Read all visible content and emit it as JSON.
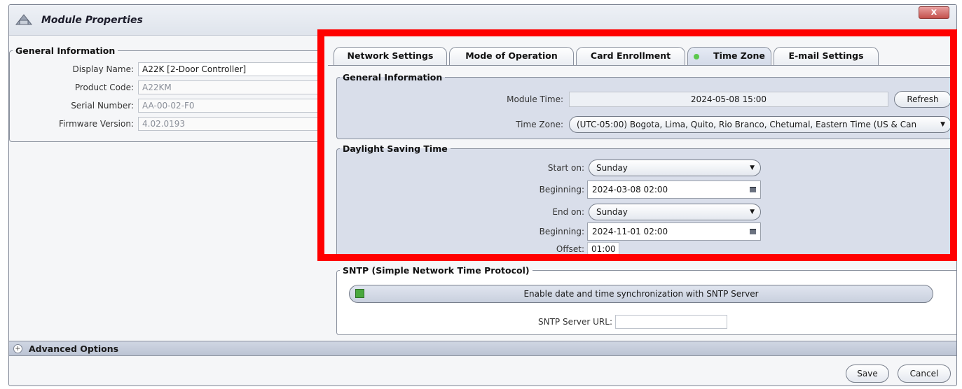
{
  "window": {
    "title": "Module Properties",
    "close_label": "x"
  },
  "general_info_left": {
    "legend": "General Information",
    "fields": [
      {
        "label": "Display Name:",
        "value": "A22K [2-Door Controller]"
      },
      {
        "label": "Product Code:",
        "value": "A22KM"
      },
      {
        "label": "Serial Number:",
        "value": "AA-00-02-F0"
      },
      {
        "label": "Firmware Version:",
        "value": "4.02.0193"
      }
    ]
  },
  "tabs": [
    {
      "label": "Network Settings"
    },
    {
      "label": "Mode of Operation"
    },
    {
      "label": "Card Enrollment"
    },
    {
      "label": "Time Zone",
      "active": true
    },
    {
      "label": "E-mail Settings"
    }
  ],
  "time_zone_tab": {
    "general": {
      "legend": "General Information",
      "module_time_label": "Module Time:",
      "module_time_value": "2024-05-08 15:00",
      "refresh_label": "Refresh",
      "time_zone_label": "Time Zone:",
      "time_zone_value": "(UTC-05:00) Bogota, Lima, Quito, Rio Branco, Chetumal, Eastern Time (US & Can"
    },
    "dst": {
      "legend": "Daylight Saving Time",
      "start_on_label": "Start on:",
      "start_on_value": "Sunday",
      "beginning1_label": "Beginning:",
      "beginning1_value": "2024-03-08 02:00",
      "end_on_label": "End on:",
      "end_on_value": "Sunday",
      "beginning2_label": "Beginning:",
      "beginning2_value": "2024-11-01 02:00",
      "offset_label": "Offset:",
      "offset_value": "01:00"
    },
    "sntp": {
      "legend": "SNTP (Simple Network Time Protocol)",
      "enable_label": "Enable date and time synchronization with SNTP Server",
      "enable_checked": true,
      "url_label": "SNTP Server URL:",
      "url_value": ""
    }
  },
  "advanced": {
    "label": "Advanced Options",
    "toggle": "+"
  },
  "footer": {
    "save_label": "Save",
    "cancel_label": "Cancel"
  },
  "colors": {
    "highlight": "#ff0000",
    "group_bg": "#d9deea",
    "active_dot": "#5bc84c"
  }
}
